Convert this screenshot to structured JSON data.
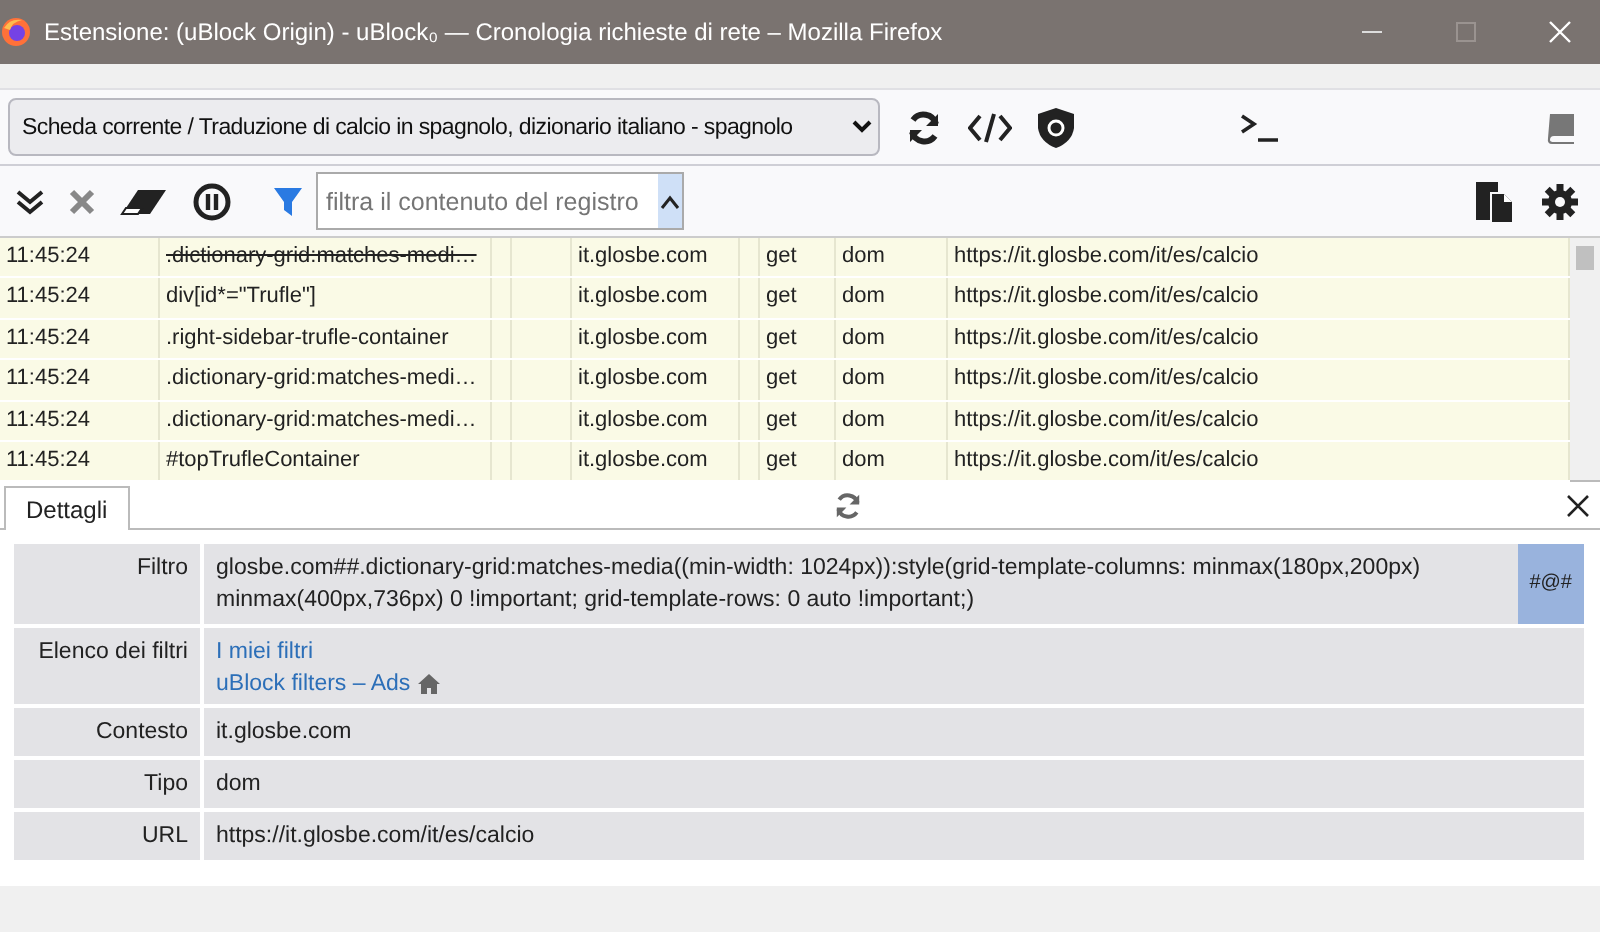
{
  "window": {
    "title": "Estensione: (uBlock Origin) - uBlock₀ — Cronologia richieste di rete – Mozilla Firefox"
  },
  "toolbar": {
    "tab_select": "Scheda corrente / Traduzione di calcio in spagnolo, dizionario italiano - spagnolo"
  },
  "filter_bar": {
    "placeholder": "filtra il contenuto del registro"
  },
  "log": {
    "rows": [
      {
        "time": "11:45:24",
        "filter": ".dictionary-grid:matches-medi…",
        "struck": true,
        "domain": "it.glosbe.com",
        "method": "get",
        "type": "dom",
        "url": "https://it.glosbe.com/it/es/calcio"
      },
      {
        "time": "11:45:24",
        "filter": "div[id*=\"Trufle\"]",
        "struck": false,
        "domain": "it.glosbe.com",
        "method": "get",
        "type": "dom",
        "url": "https://it.glosbe.com/it/es/calcio"
      },
      {
        "time": "11:45:24",
        "filter": ".right-sidebar-trufle-container",
        "struck": false,
        "domain": "it.glosbe.com",
        "method": "get",
        "type": "dom",
        "url": "https://it.glosbe.com/it/es/calcio"
      },
      {
        "time": "11:45:24",
        "filter": ".dictionary-grid:matches-medi…",
        "struck": false,
        "domain": "it.glosbe.com",
        "method": "get",
        "type": "dom",
        "url": "https://it.glosbe.com/it/es/calcio"
      },
      {
        "time": "11:45:24",
        "filter": ".dictionary-grid:matches-medi…",
        "struck": false,
        "domain": "it.glosbe.com",
        "method": "get",
        "type": "dom",
        "url": "https://it.glosbe.com/it/es/calcio"
      },
      {
        "time": "11:45:24",
        "filter": "#topTrufleContainer",
        "struck": false,
        "domain": "it.glosbe.com",
        "method": "get",
        "type": "dom",
        "url": "https://it.glosbe.com/it/es/calcio"
      }
    ]
  },
  "details": {
    "tabs": [
      {
        "label": "Dettagli",
        "selected": true
      }
    ],
    "rows": [
      {
        "kind": "text",
        "label": "Filtro",
        "value": "glosbe.com##.dictionary-grid:matches-media((min-width: 1024px)):style(grid-template-columns: minmax(180px,200px) minmax(400px,736px) 0 !important; grid-template-rows: 0 auto !important;)",
        "badge": "#@#"
      },
      {
        "kind": "links",
        "label": "Elenco dei filtri",
        "links": [
          {
            "text": "I miei filtri",
            "home": false
          },
          {
            "text": "uBlock filters – Ads",
            "home": true
          }
        ]
      },
      {
        "kind": "text",
        "label": "Contesto",
        "value": "it.glosbe.com"
      },
      {
        "kind": "text",
        "label": "Tipo",
        "value": "dom"
      },
      {
        "kind": "text",
        "label": "URL",
        "value": "https://it.glosbe.com/it/es/calcio"
      }
    ]
  }
}
